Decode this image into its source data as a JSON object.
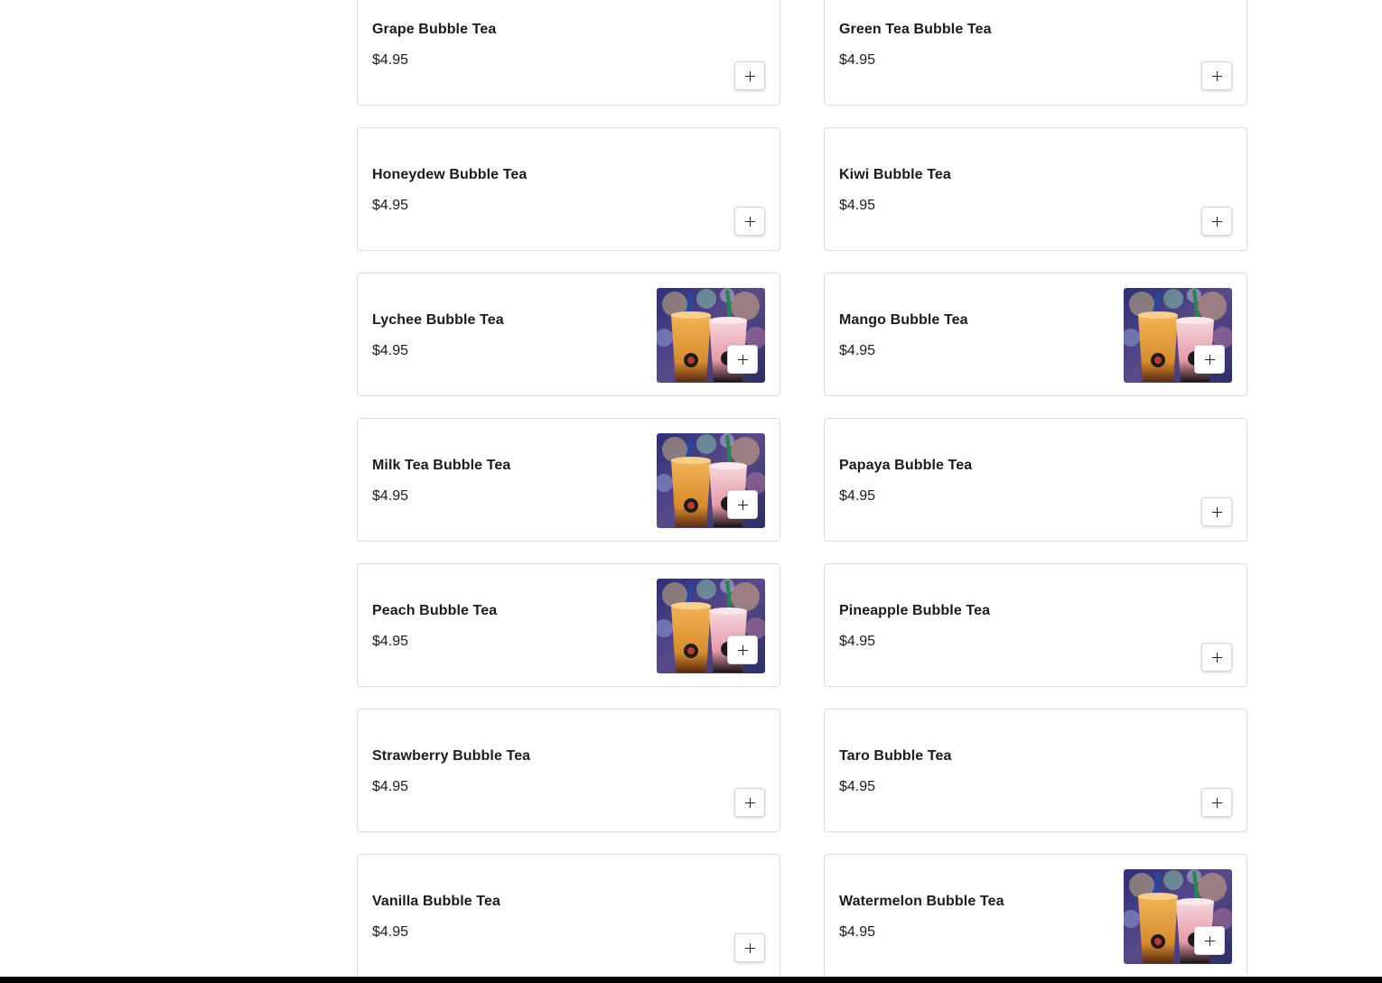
{
  "menu": {
    "items": [
      {
        "name": "Grape Bubble Tea",
        "price": "$4.95",
        "has_image": false
      },
      {
        "name": "Green Tea Bubble Tea",
        "price": "$4.95",
        "has_image": false
      },
      {
        "name": "Honeydew Bubble Tea",
        "price": "$4.95",
        "has_image": false
      },
      {
        "name": "Kiwi Bubble Tea",
        "price": "$4.95",
        "has_image": false
      },
      {
        "name": "Lychee Bubble Tea",
        "price": "$4.95",
        "has_image": true
      },
      {
        "name": "Mango Bubble Tea",
        "price": "$4.95",
        "has_image": true
      },
      {
        "name": "Milk Tea Bubble Tea",
        "price": "$4.95",
        "has_image": true
      },
      {
        "name": "Papaya Bubble Tea",
        "price": "$4.95",
        "has_image": false
      },
      {
        "name": "Peach Bubble Tea",
        "price": "$4.95",
        "has_image": true
      },
      {
        "name": "Pineapple Bubble Tea",
        "price": "$4.95",
        "has_image": false
      },
      {
        "name": "Strawberry Bubble Tea",
        "price": "$4.95",
        "has_image": false
      },
      {
        "name": "Taro Bubble Tea",
        "price": "$4.95",
        "has_image": false
      },
      {
        "name": "Vanilla Bubble Tea",
        "price": "$4.95",
        "has_image": false
      },
      {
        "name": "Watermelon Bubble Tea",
        "price": "$4.95",
        "has_image": true
      }
    ],
    "add_icon": "plus-icon"
  }
}
